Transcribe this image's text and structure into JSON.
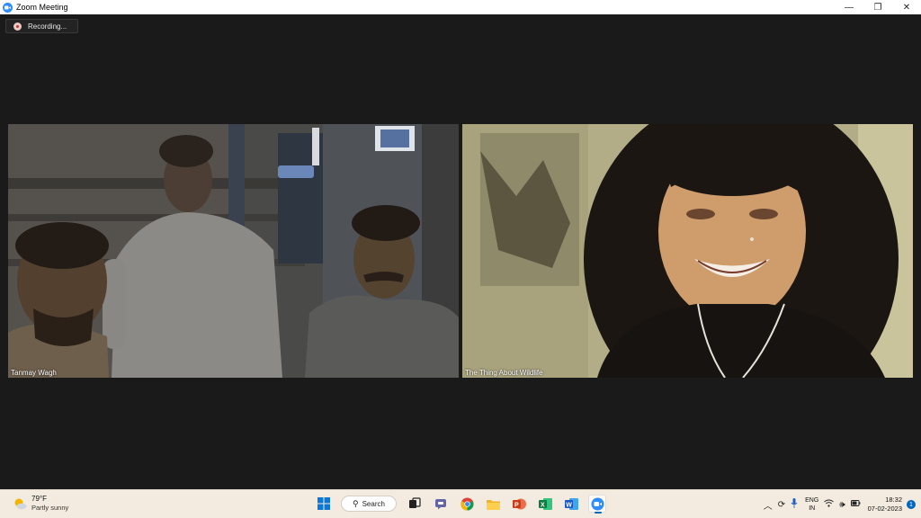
{
  "window": {
    "title": "Zoom Meeting",
    "controls": [
      "—",
      "❐",
      "✕"
    ]
  },
  "recording": {
    "label": "Recording..."
  },
  "participants": [
    {
      "name": "Tanmay Wagh"
    },
    {
      "name": "The Thing About Wildlife"
    }
  ],
  "taskbar": {
    "weather": {
      "temp": "79°F",
      "condition": "Partly sunny",
      "icon": "partly-sunny-icon"
    },
    "search_label": "Search",
    "apps": [
      "windows-start-icon",
      "search",
      "task-view-icon",
      "teams-chat-icon",
      "chrome-icon",
      "file-explorer-icon",
      "powerpoint-icon",
      "excel-icon",
      "word-icon",
      "zoom-icon"
    ],
    "tray": {
      "language_line1": "ENG",
      "language_line2": "IN",
      "time": "18:32",
      "date": "07-02-2023",
      "notification_count": "1"
    }
  },
  "colors": {
    "zoom_blue": "#2D8CFF",
    "meeting_bg": "#1a1a1a",
    "taskbar_bg": "#f3ebdf",
    "accent": "#0067c0"
  }
}
